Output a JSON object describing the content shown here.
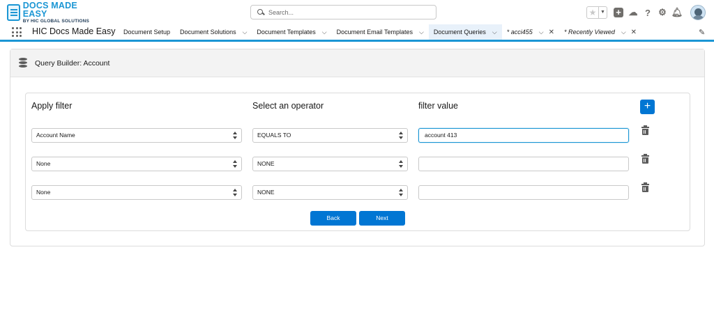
{
  "header": {
    "logo_title": "DOCS MADE EASY",
    "logo_subtitle": "BY HIC GLOBAL SOLUTIONS",
    "search_placeholder": "Search..."
  },
  "nav": {
    "app_name": "HIC Docs Made Easy",
    "tabs": [
      {
        "label": "Document Setup",
        "has_chevron": false
      },
      {
        "label": "Document Solutions",
        "has_chevron": true
      },
      {
        "label": "Document Templates",
        "has_chevron": true
      },
      {
        "label": "Document Email Templates",
        "has_chevron": true
      },
      {
        "label": "Document Queries",
        "has_chevron": true,
        "active": true
      },
      {
        "label": "* acci455",
        "has_chevron": true,
        "closable": true
      },
      {
        "label": "* Recently Viewed",
        "has_chevron": true,
        "closable": true
      }
    ]
  },
  "page": {
    "title": "Query Builder: Account",
    "columns": {
      "filter": "Apply filter",
      "operator": "Select an operator",
      "value": "filter value"
    },
    "rows": [
      {
        "field": "Account Name",
        "operator": "EQUALS TO",
        "value": "account 413"
      },
      {
        "field": "None",
        "operator": "NONE",
        "value": ""
      },
      {
        "field": "None",
        "operator": "NONE",
        "value": ""
      }
    ],
    "add_label": "+",
    "back_label": "Back",
    "next_label": "Next"
  },
  "colors": {
    "brand": "#0176d3",
    "accent": "#1b96d4"
  }
}
